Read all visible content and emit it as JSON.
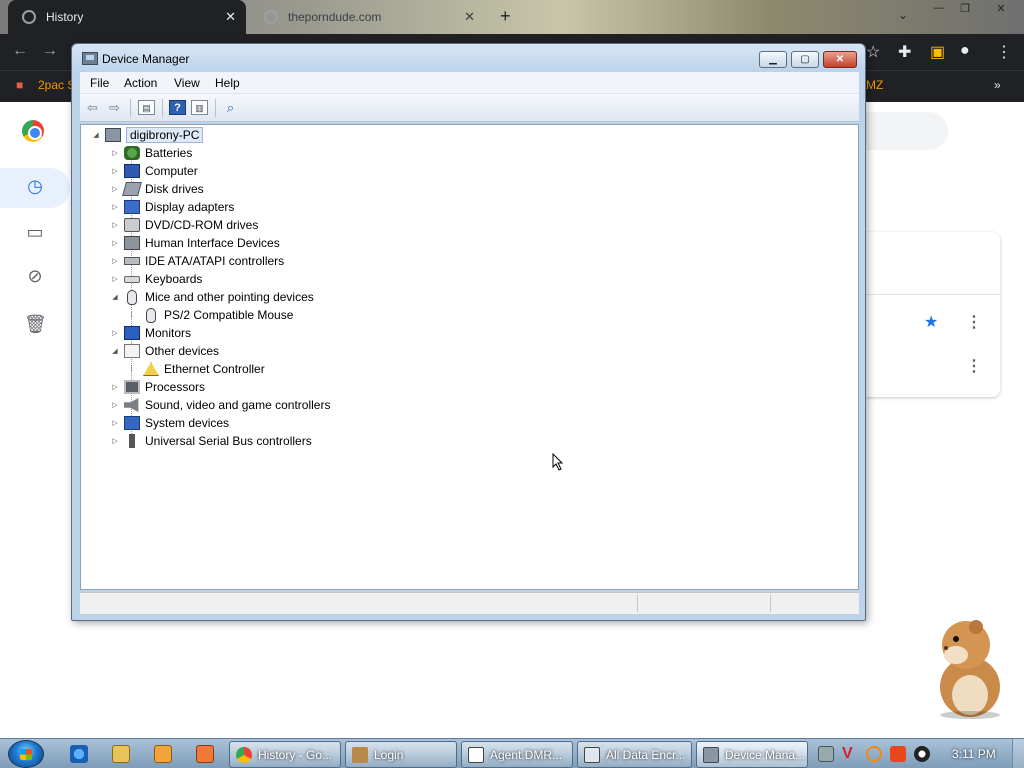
{
  "chrome": {
    "tabs": [
      {
        "title": "History",
        "active": true
      },
      {
        "title": "theporndude.com",
        "active": false
      }
    ],
    "bookmark_first": "2pac S",
    "bookmark_last": "MZ",
    "bookmarks_overflow": "»"
  },
  "device_manager": {
    "title": "Device Manager",
    "menu": [
      "File",
      "Action",
      "View",
      "Help"
    ],
    "tree": {
      "root": "digibrony-PC",
      "categories": [
        {
          "label": "Batteries",
          "expanded": false,
          "icon": "battery-icon"
        },
        {
          "label": "Computer",
          "expanded": false,
          "icon": "computer-icon"
        },
        {
          "label": "Disk drives",
          "expanded": false,
          "icon": "disk-drive-icon"
        },
        {
          "label": "Display adapters",
          "expanded": false,
          "icon": "display-adapter-icon"
        },
        {
          "label": "DVD/CD-ROM drives",
          "expanded": false,
          "icon": "dvd-drive-icon"
        },
        {
          "label": "Human Interface Devices",
          "expanded": false,
          "icon": "hid-icon"
        },
        {
          "label": "IDE ATA/ATAPI controllers",
          "expanded": false,
          "icon": "ide-controller-icon"
        },
        {
          "label": "Keyboards",
          "expanded": false,
          "icon": "keyboard-icon"
        },
        {
          "label": "Mice and other pointing devices",
          "expanded": true,
          "icon": "mouse-icon",
          "children": [
            {
              "label": "PS/2 Compatible Mouse",
              "icon": "mouse-icon"
            }
          ]
        },
        {
          "label": "Monitors",
          "expanded": false,
          "icon": "monitor-icon"
        },
        {
          "label": "Other devices",
          "expanded": true,
          "icon": "unknown-device-icon",
          "children": [
            {
              "label": "Ethernet Controller",
              "icon": "warning-device-icon"
            }
          ]
        },
        {
          "label": "Processors",
          "expanded": false,
          "icon": "processor-icon"
        },
        {
          "label": "Sound, video and game controllers",
          "expanded": false,
          "icon": "speaker-icon"
        },
        {
          "label": "System devices",
          "expanded": false,
          "icon": "system-device-icon"
        },
        {
          "label": "Universal Serial Bus controllers",
          "expanded": false,
          "icon": "usb-icon"
        }
      ]
    }
  },
  "taskbar": {
    "buttons": [
      {
        "label": "History - Go...",
        "icon": "chrome-icon"
      },
      {
        "label": "Login",
        "icon": "app-icon"
      },
      {
        "label": "Agent.DMR...",
        "icon": "window-icon"
      },
      {
        "label": "All Data Encr...",
        "icon": "window-icon"
      },
      {
        "label": "Device Mana...",
        "icon": "device-manager-icon",
        "active": true
      }
    ],
    "clock": "3:11 PM"
  },
  "colors": {
    "chrome_dark": "#202124",
    "window_frame": "#bcd3ea",
    "close_button": "#c4402a",
    "taskbar": "#7f9db8"
  }
}
